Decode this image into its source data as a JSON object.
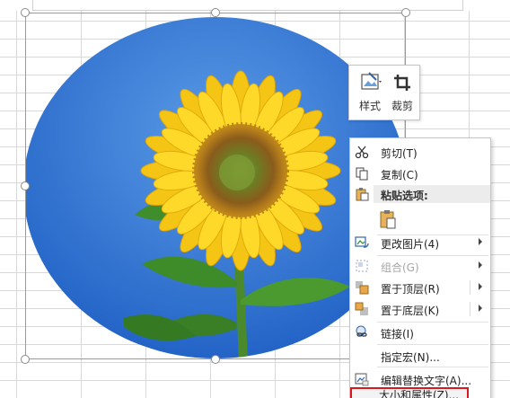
{
  "colors": {
    "sky": "#2c6fd1",
    "petal": "#f6cf16",
    "center": "#7a5a18",
    "leaf": "#3d8a2a",
    "highlight": "#d71920"
  },
  "mini_toolbar": {
    "style_label": "样式",
    "crop_label": "裁剪"
  },
  "context_menu": {
    "cut": "剪切(T)",
    "copy": "复制(C)",
    "paste_options": "粘贴选项:",
    "change_picture": "更改图片(4)",
    "group": "组合(G)",
    "bring_to_front": "置于顶层(R)",
    "send_to_back": "置于底层(K)",
    "link": "链接(I)",
    "assign_macro": "指定宏(N)...",
    "edit_alt_text": "编辑替换文字(A)...",
    "size_and_properties": "大小和属性(Z)..."
  }
}
